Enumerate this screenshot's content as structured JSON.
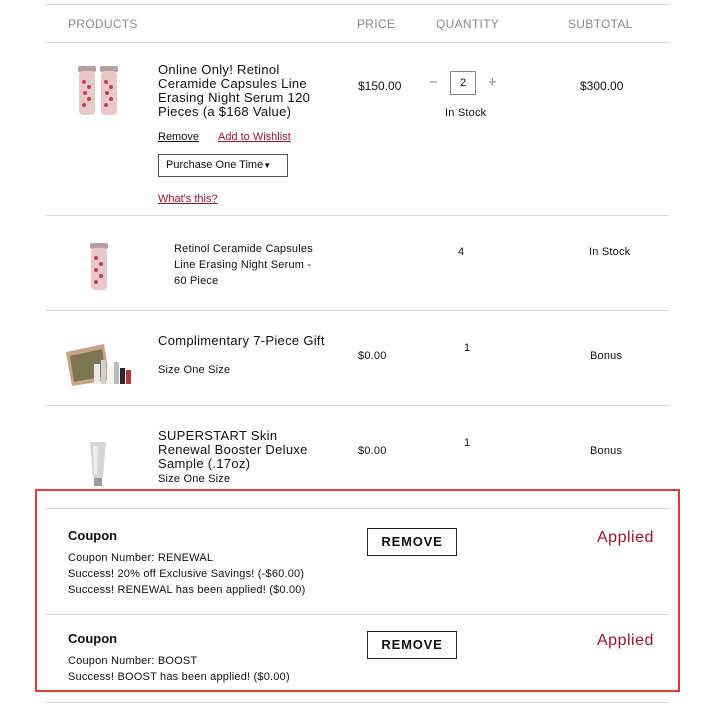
{
  "columns": {
    "products": "PRODUCTS",
    "price": "PRICE",
    "quantity": "QUANTITY",
    "subtotal": "SUBTOTAL"
  },
  "items": [
    {
      "name": "Online Only! Retinol Ceramide Capsules Line Erasing Night Serum 120 Pieces (a $168 Value)",
      "price": "$150.00",
      "quantity": "2",
      "stock": "In Stock",
      "subtotal": "$300.00",
      "remove_label": "Remove",
      "wishlist_label": "Add to Wishlist",
      "purchase_option": "Purchase One Time",
      "whats_this": "What's this?"
    },
    {
      "name": "Retinol Ceramide Capsules Line Erasing Night Serum - 60 Piece",
      "quantity": "4",
      "stock": "In Stock"
    },
    {
      "name": "Complimentary 7-Piece Gift",
      "size": "Size One Size",
      "price": "$0.00",
      "quantity": "1",
      "subtotal": "Bonus"
    },
    {
      "name": "SUPERSTART Skin Renewal Booster Deluxe Sample (.17oz)",
      "size": "Size One Size",
      "price": "$0.00",
      "quantity": "1",
      "subtotal": "Bonus"
    }
  ],
  "coupons": [
    {
      "title": "Coupon",
      "lines": [
        "Coupon Number: RENEWAL",
        "Success! 20% off Exclusive Savings! (-$60.00)",
        "Success! RENEWAL has been applied! ($0.00)"
      ],
      "button": "REMOVE",
      "status": "Applied"
    },
    {
      "title": "Coupon",
      "lines": [
        "Coupon Number: BOOST",
        "Success! BOOST has been applied! ($0.00)"
      ],
      "button": "REMOVE",
      "status": "Applied"
    }
  ],
  "colors": {
    "accent_red": "#a0142a",
    "highlight_box": "#e23b3b",
    "divider": "#d9d9d9"
  }
}
